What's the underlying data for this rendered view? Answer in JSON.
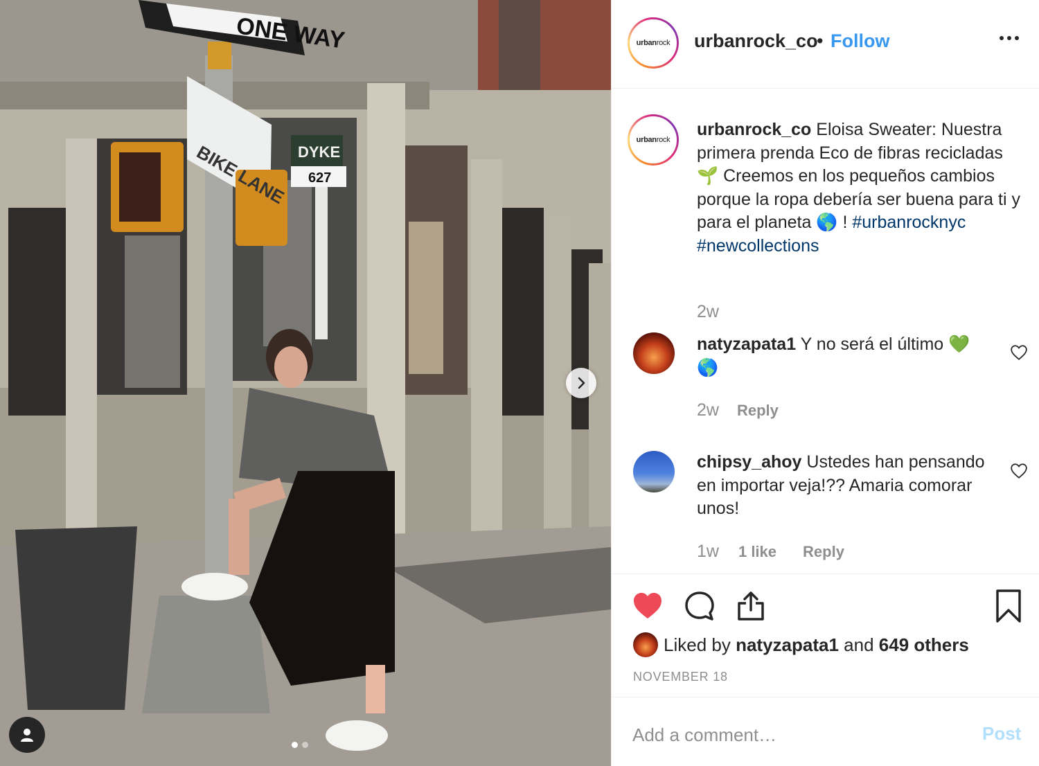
{
  "photo": {
    "street_signs": {
      "one_way": "ONE WAY",
      "bike_lane": "BIKE LANE",
      "dyke": "DYKE",
      "dyke_number": "627"
    },
    "carousel": {
      "total": 2,
      "current": 1
    },
    "next_icon": "chevron-right-icon",
    "user_tag_icon": "person-icon"
  },
  "header": {
    "logo_text_bold": "urban",
    "logo_text_light": "rock",
    "username": "urbanrock_co",
    "separator": "•",
    "follow_label": "Follow"
  },
  "caption": {
    "username": "urbanrock_co",
    "text_part1": " Eloisa Sweater: Nuestra primera prenda Eco de fibras recicladas ",
    "emoji_seedling": "🌱",
    "text_part2": "  Creemos en los pequeños cambios porque la ropa debería ser buena para ti y para el planeta ",
    "emoji_globe": "🌎",
    "text_part3": " ! ",
    "hashtag1": "#urbanrocknyc",
    "hashtag2": "#newcollections",
    "time": "2w"
  },
  "comments": [
    {
      "username": "natyzapata1",
      "text": " Y no será el último ",
      "emoji1": "💚",
      "emoji2": "🌎",
      "time": "2w",
      "reply_label": "Reply"
    },
    {
      "username": "chipsy_ahoy",
      "text": " Ustedes han pensando en importar veja!?? Amaria comorar unos!",
      "time": "1w",
      "likes_label": "1 like",
      "reply_label": "Reply"
    }
  ],
  "actions": {
    "liked_by_prefix": "Liked by ",
    "liked_by_user": "natyzapata1",
    "liked_by_and": " and ",
    "liked_by_others": "649 others",
    "date": "NOVEMBER 18",
    "like_color": "#ed4956"
  },
  "comment_box": {
    "placeholder": "Add a comment…",
    "post_label": "Post"
  }
}
